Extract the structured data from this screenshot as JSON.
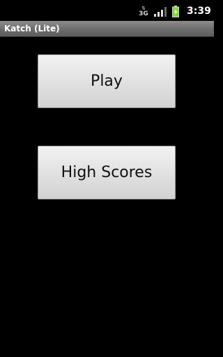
{
  "status_bar": {
    "network_type": "3G",
    "network_arrows": "⇅",
    "time": "3:39",
    "colors": {
      "battery_charging": "#7fdc2a",
      "signal": "#e0e0e0"
    }
  },
  "app": {
    "title": "Katch (Lite)"
  },
  "menu": {
    "play_label": "Play",
    "high_scores_label": "High Scores"
  }
}
